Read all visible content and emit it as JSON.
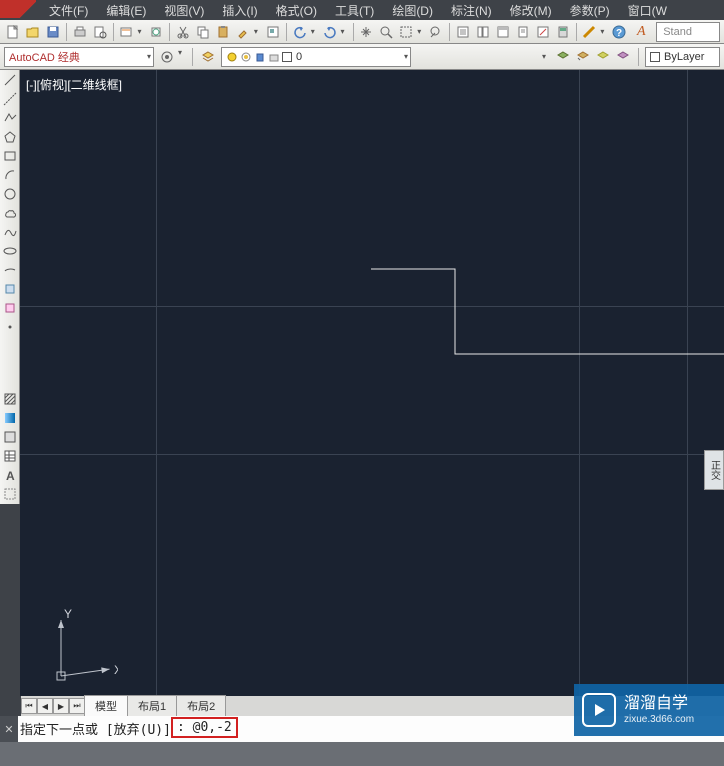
{
  "menu": {
    "file": "文件(F)",
    "edit": "编辑(E)",
    "view": "视图(V)",
    "insert": "插入(I)",
    "format": "格式(O)",
    "tools": "工具(T)",
    "draw": "绘图(D)",
    "dim": "标注(N)",
    "modify": "修改(M)",
    "param": "参数(P)",
    "window": "窗口(W"
  },
  "workspace": {
    "label": "AutoCAD 经典"
  },
  "layer": {
    "current": "0"
  },
  "linetype": {
    "current": "ByLayer"
  },
  "textstyle": {
    "label": "Stand"
  },
  "viewport": {
    "label": "[-][俯视][二维线框]"
  },
  "right_panel": {
    "label": "正交"
  },
  "ucs": {
    "y": "Y",
    "x": "X"
  },
  "tabs": {
    "model": "模型",
    "layout1": "布局1",
    "layout2": "布局2"
  },
  "command": {
    "prompt_pre": "指定下一点或 [放弃(U)]",
    "prompt_sep": ": ",
    "input": "@0,-2"
  },
  "watermark": {
    "title": "溜溜自学",
    "sub": "zixue.3d66.com"
  },
  "colors": {
    "canvas_bg": "#1a2230",
    "ui_bg": "#3e4248",
    "highlight_red": "#d22020",
    "watermark_bg": "#0f64a5"
  }
}
